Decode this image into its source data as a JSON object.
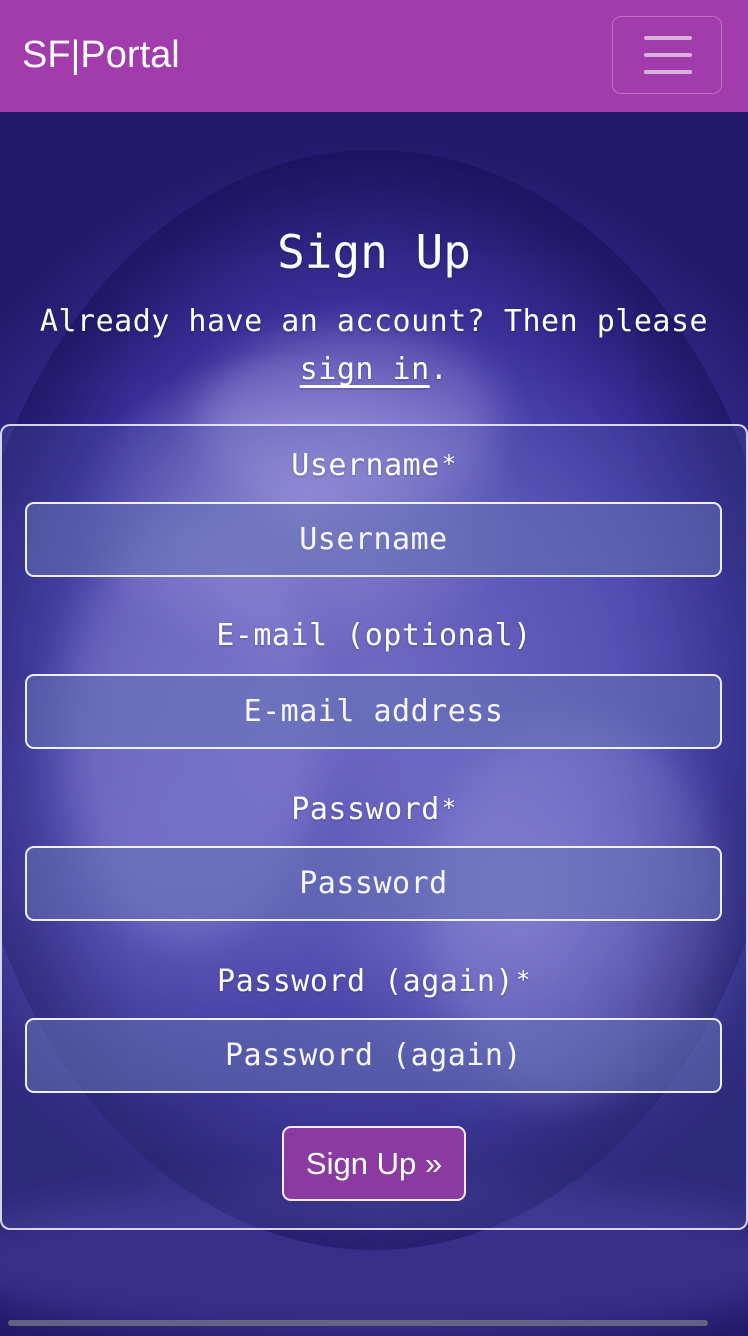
{
  "navbar": {
    "brand": "SF|Portal",
    "toggler_icon": "hamburger-menu-icon"
  },
  "header": {
    "title": "Sign Up",
    "subtitle_prefix": "Already have an account? Then please",
    "signin_link": "sign in",
    "subtitle_suffix": "."
  },
  "form": {
    "username": {
      "label": "Username",
      "required_mark": "*",
      "placeholder": "Username",
      "value": ""
    },
    "email": {
      "label": "E-mail (optional)",
      "placeholder": "E-mail address",
      "value": ""
    },
    "password": {
      "label": "Password",
      "required_mark": "*",
      "placeholder": "Password",
      "value": ""
    },
    "password_again": {
      "label": "Password (again)",
      "required_mark": "*",
      "placeholder": "Password (again)",
      "value": ""
    },
    "submit_label": "Sign Up »"
  },
  "colors": {
    "navbar": "#a23bab",
    "button": "#8a3aa0",
    "text": "#ffffff"
  }
}
